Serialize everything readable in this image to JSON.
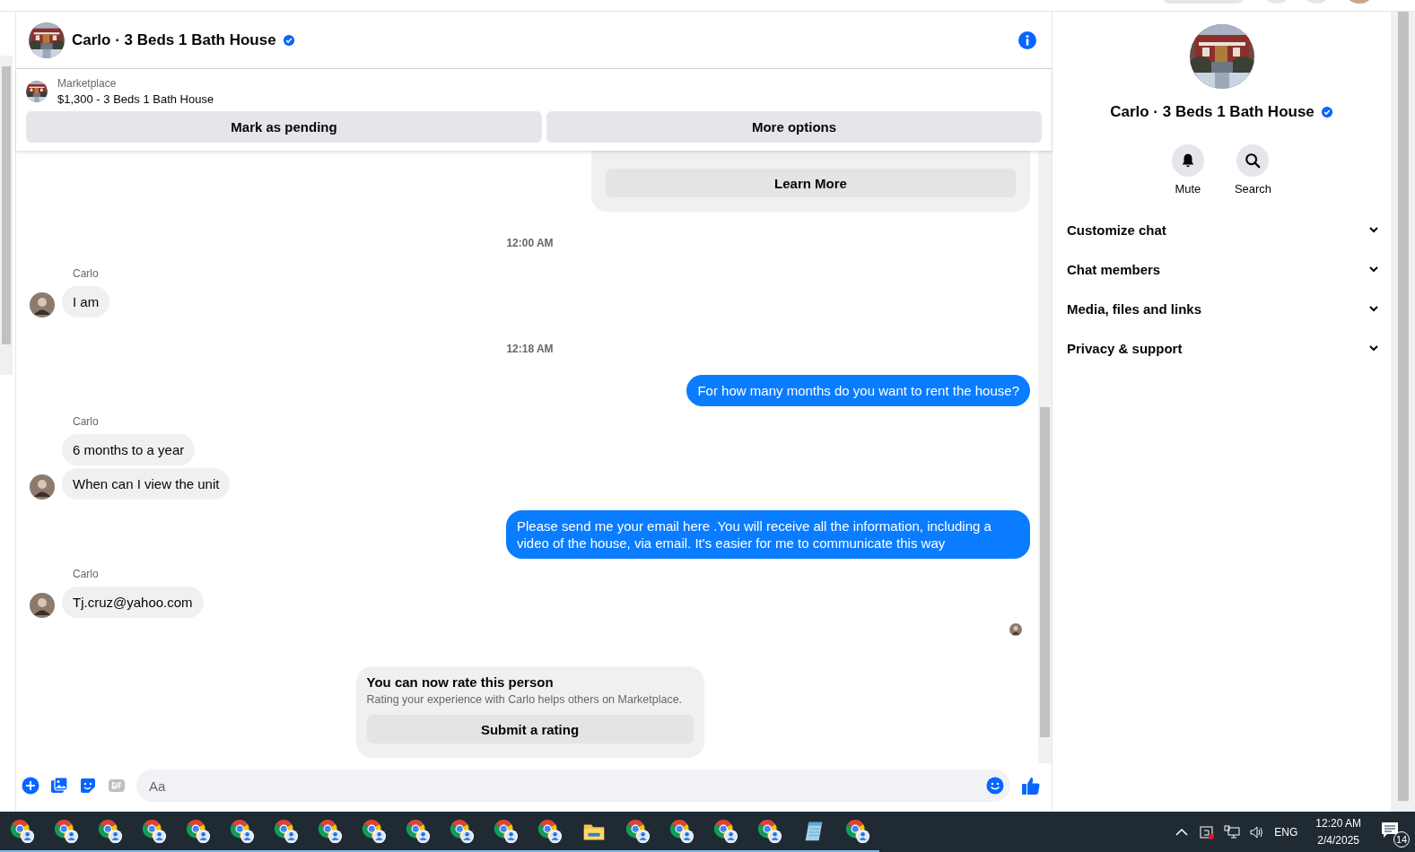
{
  "header": {
    "title": "Carlo · 3 Beds 1 Bath House",
    "verified": true
  },
  "listing": {
    "source": "Marketplace",
    "title": "$1,300 - 3 Beds 1 Bath House",
    "buttons": [
      "Mark as pending",
      "More options"
    ]
  },
  "messages": [
    {
      "kind": "notice",
      "button": "Learn More"
    },
    {
      "kind": "time",
      "text": "12:00 AM"
    },
    {
      "kind": "incoming",
      "sender": "Carlo",
      "bubbles": [
        "I am"
      ]
    },
    {
      "kind": "time",
      "text": "12:18 AM"
    },
    {
      "kind": "outgoing",
      "bubbles": [
        "For how many months do you want to rent the house?"
      ]
    },
    {
      "kind": "incoming",
      "sender": "Carlo",
      "bubbles": [
        "6 months to a year",
        "When can I view the unit"
      ]
    },
    {
      "kind": "outgoing",
      "bubbles": [
        "Please send me your email here .You will receive all the information, including a video of the house, via email. It's easier for me to communicate this way"
      ]
    },
    {
      "kind": "incoming",
      "sender": "Carlo",
      "bubbles": [
        "Tj.cruz@yahoo.com"
      ]
    },
    {
      "kind": "seen"
    },
    {
      "kind": "rating",
      "title": "You can now rate this person",
      "text": "Rating your experience with Carlo helps others on Marketplace.",
      "button": "Submit a rating"
    }
  ],
  "composer": {
    "placeholder": "Aa"
  },
  "details": {
    "name": "Carlo · 3 Beds 1 Bath House",
    "verified": true,
    "actions": [
      {
        "kind": "mute",
        "label": "Mute"
      },
      {
        "kind": "search",
        "label": "Search"
      }
    ],
    "sections": [
      {
        "label": "Customize chat",
        "expanded": false
      },
      {
        "label": "Chat members",
        "expanded": false
      },
      {
        "label": "Media, files and links",
        "expanded": false
      },
      {
        "label": "Privacy & support",
        "expanded": false
      }
    ]
  },
  "taskbar": {
    "apps": [
      {
        "kind": "chrome"
      },
      {
        "kind": "chrome"
      },
      {
        "kind": "chrome"
      },
      {
        "kind": "chrome"
      },
      {
        "kind": "chrome"
      },
      {
        "kind": "chrome"
      },
      {
        "kind": "chrome"
      },
      {
        "kind": "chrome"
      },
      {
        "kind": "chrome"
      },
      {
        "kind": "chrome"
      },
      {
        "kind": "chrome"
      },
      {
        "kind": "chrome"
      },
      {
        "kind": "chrome"
      },
      {
        "kind": "folder"
      },
      {
        "kind": "chrome"
      },
      {
        "kind": "chrome"
      },
      {
        "kind": "chrome"
      },
      {
        "kind": "chrome"
      },
      {
        "kind": "notepad"
      },
      {
        "kind": "chrome"
      }
    ],
    "tray": {
      "language": "ENG",
      "time": "12:20 AM",
      "date": "2/4/2025",
      "notifications": "14"
    }
  }
}
